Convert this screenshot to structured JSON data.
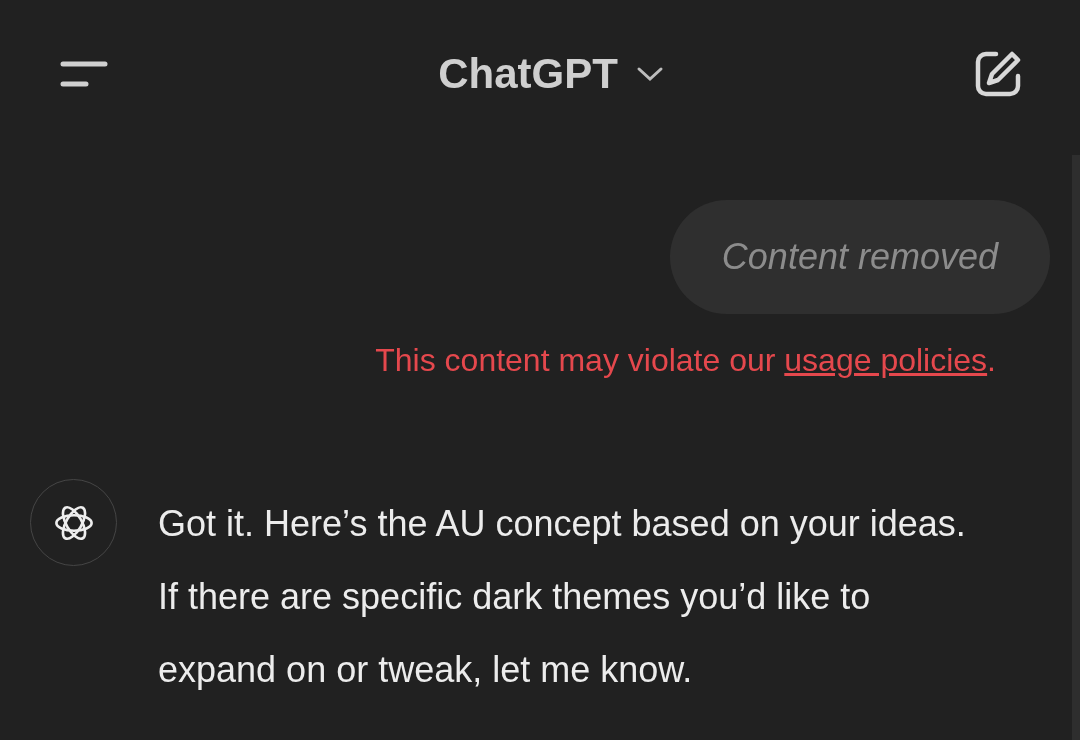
{
  "header": {
    "title": "ChatGPT"
  },
  "messages": [
    {
      "kind": "removed",
      "text": "Content removed",
      "warning": "This content may violate our",
      "link": "usage policies",
      "end": "."
    },
    {
      "kind": "assistant",
      "text": "Got it. Here’s the AU concept based on your ideas. If there are specific dark themes you’d like to expand on or tweak, let me know."
    }
  ]
}
